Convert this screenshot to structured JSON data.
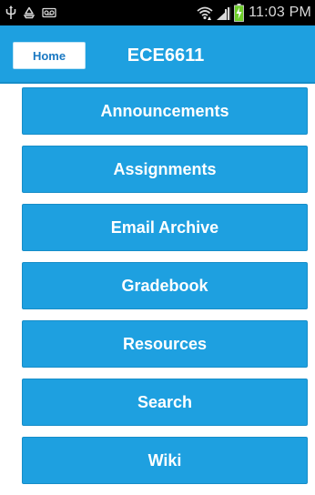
{
  "status_bar": {
    "time": "11:03 PM",
    "icons": [
      "usb-icon",
      "recycle-icon",
      "voicemail-icon",
      "wifi-icon",
      "signal-icon",
      "battery-charging-icon"
    ]
  },
  "header": {
    "home_label": "Home",
    "title": "ECE6611"
  },
  "menu": {
    "items": [
      {
        "label": "Announcements"
      },
      {
        "label": "Assignments"
      },
      {
        "label": "Email Archive"
      },
      {
        "label": "Gradebook"
      },
      {
        "label": "Resources"
      },
      {
        "label": "Search"
      },
      {
        "label": "Wiki"
      }
    ]
  },
  "colors": {
    "accent": "#1ea0e0",
    "accent_border": "#168dc8",
    "home_text": "#1a78c2",
    "status_bar_bg": "#000000",
    "battery": "#6ecf2a"
  }
}
